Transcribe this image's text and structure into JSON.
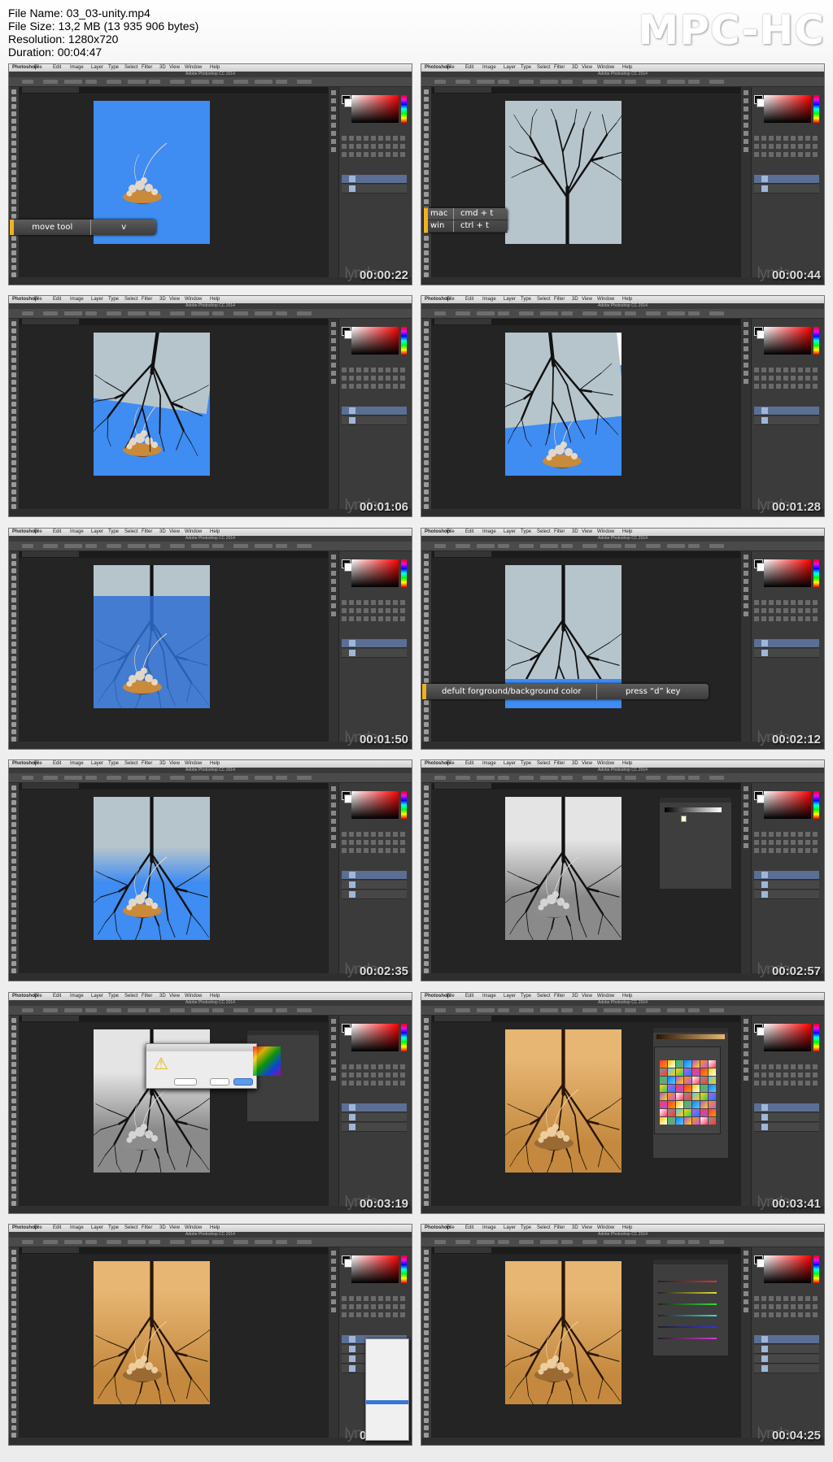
{
  "file_info": {
    "file_name": "File Name: 03_03-unity.mp4",
    "file_size": "File Size: 13,2 MB (13 935 906 bytes)",
    "resolution": "Resolution: 1280x720",
    "duration": "Duration: 00:04:47"
  },
  "brand": "MPC-HC",
  "watermark": "lynda",
  "thumbnails": [
    {
      "timestamp": "00:00:22",
      "hint": {
        "action": "move tool",
        "key": "v"
      }
    },
    {
      "timestamp": "00:00:44",
      "shortcut": {
        "mac_label": "mac",
        "mac_keys": "cmd + t",
        "win_label": "win",
        "win_keys": "ctrl + t"
      }
    },
    {
      "timestamp": "00:01:06"
    },
    {
      "timestamp": "00:01:28"
    },
    {
      "timestamp": "00:01:50"
    },
    {
      "timestamp": "00:02:12",
      "hint": {
        "action": "defult forground/background color",
        "key": "press “d” key"
      }
    },
    {
      "timestamp": "00:02:35"
    },
    {
      "timestamp": "00:02:57"
    },
    {
      "timestamp": "00:03:19"
    },
    {
      "timestamp": "00:03:41"
    },
    {
      "timestamp": "00:04:03"
    },
    {
      "timestamp": "00:04:25"
    }
  ],
  "app": {
    "menu": [
      "Photoshop",
      "File",
      "Edit",
      "Image",
      "Layer",
      "Type",
      "Select",
      "Filter",
      "3D",
      "View",
      "Window",
      "Help"
    ],
    "title": "Adobe Photoshop CC 2014"
  },
  "colors": {
    "blue_bg": "#3f8cf2",
    "sky": "#b6c5cc",
    "sepia": "#d69a48",
    "hint_accent": "#f0b020"
  }
}
